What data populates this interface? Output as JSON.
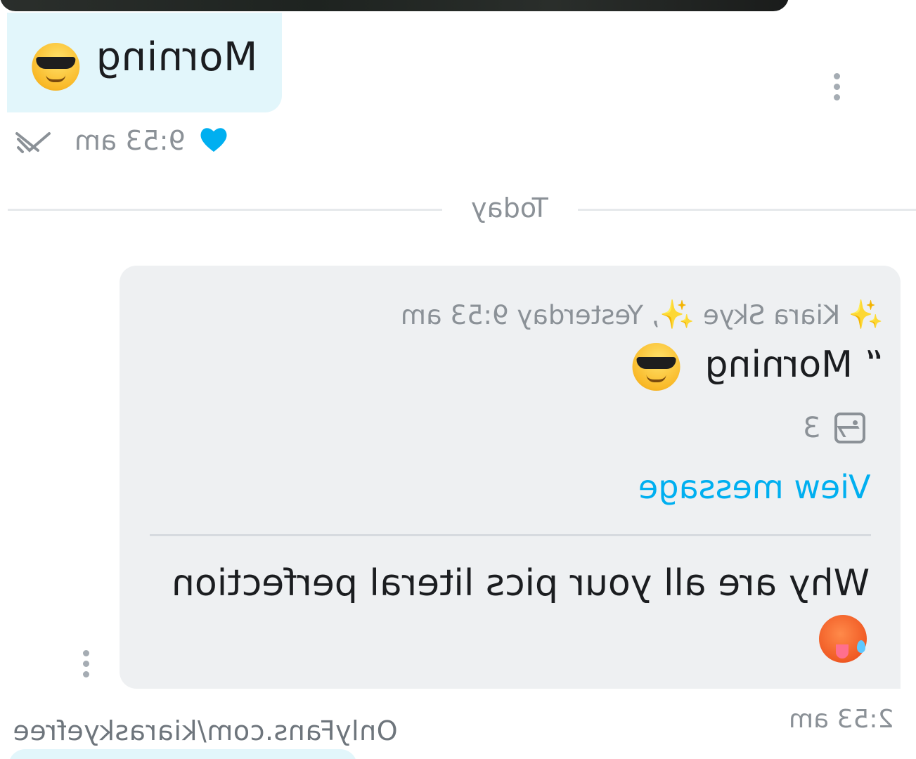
{
  "received_message": {
    "text": "Morning",
    "emoji": "smiling-face-with-sunglasses",
    "time": "9:53 am",
    "reaction": "blue-heart-icon",
    "read_status": "double-check-icon"
  },
  "date_divider": {
    "label": "Today"
  },
  "sent_message": {
    "reply_to": {
      "sender": "Kiara Skye",
      "sender_decoration": "sparkles",
      "timestamp": "Yesterday 9:53 am",
      "quote_text": "Morning",
      "quote_emoji": "smiling-face-with-sunglasses",
      "media_count": "3",
      "view_link_label": "View message"
    },
    "text": "Why are all your pics literal perfection",
    "emoji": "hot-face",
    "time": "2:53 am"
  },
  "footer": {
    "text": "OnlyFans.com/kiaraskyefree"
  },
  "colors": {
    "received_bubble": "#e2f6fb",
    "sent_bubble": "#eef0f2",
    "accent": "#00aff0",
    "muted": "#8b9197"
  }
}
